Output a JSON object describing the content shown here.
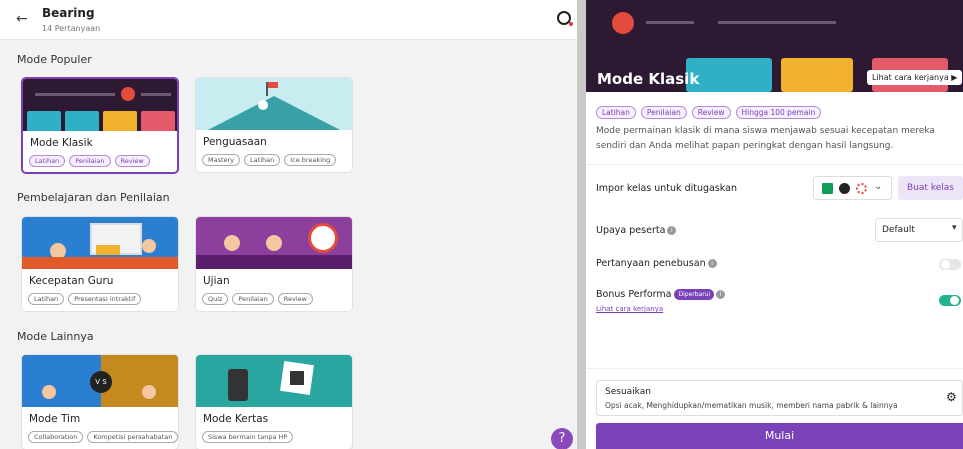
{
  "header": {
    "back_icon": "arrow-left-icon",
    "title": "Bearing",
    "subtitle": "14 Pertanyaan",
    "logo": "quizizz-logo"
  },
  "sections": {
    "popular": "Mode Populer",
    "learning": "Pembelajaran dan Penilaian",
    "other": "Mode Lainnya"
  },
  "cards": [
    {
      "name": "Mode Klasik",
      "tags": [
        "Latihan",
        "Penilaian",
        "Review"
      ]
    },
    {
      "name": "Penguasaan",
      "tags": [
        "Mastery",
        "Latihan",
        "Ice breaking"
      ]
    },
    {
      "name": "Kecepatan Guru",
      "tags": [
        "Latihan",
        "Presentasi intraktif"
      ]
    },
    {
      "name": "Ujian",
      "tags": [
        "Quiz",
        "Penilaian",
        "Review"
      ]
    },
    {
      "name": "Mode Tim",
      "tags": [
        "Collaboration",
        "Kompetisi persahabatan"
      ]
    },
    {
      "name": "Mode Kertas",
      "tags": [
        "Siswa bermain tanpa HP"
      ]
    }
  ],
  "help": "?",
  "panel": {
    "title": "Mode Klasik",
    "how_label": "Lihat cara kerjanya ▶",
    "tags": [
      "Latihan",
      "Penilaian",
      "Review",
      "Hingga 100 pemain"
    ],
    "description": "Mode permainan klasik di mana siswa menjawab sesuai kecepatan mereka sendiri dan Anda melihat papan peringkat dengan hasil langsung.",
    "import_label": "Impor kelas untuk ditugaskan",
    "import_icons": [
      "google-classroom-icon",
      "schoology-icon",
      "canvas-icon",
      "chevron-down-icon"
    ],
    "create_class": "Buat kelas",
    "attempts_label": "Upaya peserta",
    "attempts_value": "Default",
    "redemption_label": "Pertanyaan penebusan",
    "redemption_on": false,
    "bonus_label": "Bonus Performa",
    "bonus_badge": "Diperbarui",
    "bonus_link": "Lihat cara kerjanya",
    "bonus_on": true,
    "customize_title": "Sesuaikan",
    "customize_desc": "Opsi acak, Menghidupkan/mematikan musik, memberi nama pabrik & lainnya",
    "start": "Mulai"
  },
  "colors": {
    "accent": "#7a42b9",
    "toggle_on": "#1fb58f",
    "hero_bg": "#2d1a32"
  }
}
